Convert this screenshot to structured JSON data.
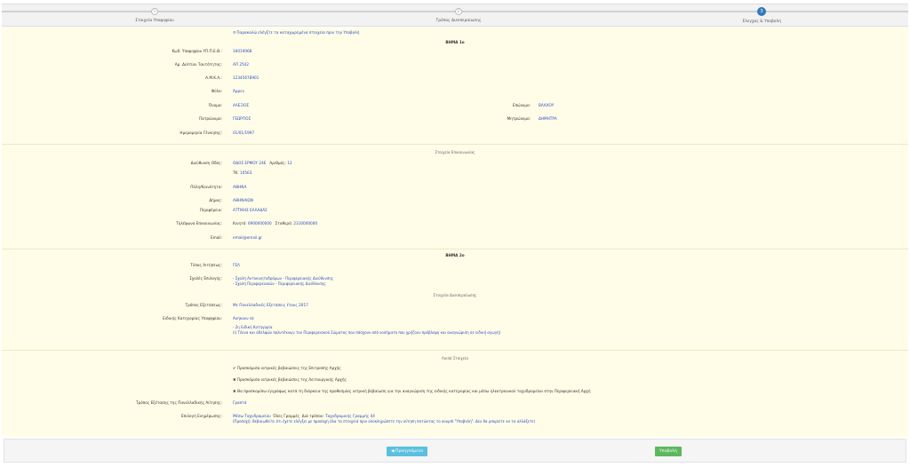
{
  "steps": [
    {
      "number": "1",
      "label": "Στοιχεία Υποψηφίου"
    },
    {
      "number": "2",
      "label": "Τρόπος Διεκπεραίωσης"
    },
    {
      "number": "3",
      "label": "Έλεγχος & Υποβολή"
    }
  ],
  "intro": "Παρακαλώ ελέγξτε τα καταχωρημένα στοιχεία πριν την Υποβολή",
  "section1": {
    "title": "ΒΗΜΑ 1ο",
    "fields": {
      "afm_label": "Κωδ. Υποψηφίου ΥΠ.Π.Ε.Θ.:",
      "afm_value": "16019068",
      "id_label": "Αρ. Δελτίου Ταυτότητας:",
      "id_value": "ΑΠ 2542",
      "amka_label": "Α.Μ.Κ.Α.:",
      "amka_value": "12345678901",
      "gender_label": "Φύλο:",
      "gender_value": "Άρρεν",
      "firstname_label": "Όνομα:",
      "firstname_value": "ΑΛΕΞΙΟΣ",
      "lastname_label": "Επώνυμο:",
      "lastname_value": "ΒΛΑΧΟΥ",
      "father_label": "Πατρώνυμο:",
      "father_value": "ΓΕΩΡΓΙΟΣ",
      "mother_label": "Μητρώνυμο:",
      "mother_value": "ΔΗΜΗΤΡΑ",
      "birthdate_label": "Ημερομηνία Γέννησης:",
      "birthdate_value": "01/01/1997"
    }
  },
  "contact": {
    "title": "Στοιχεία Επικοινωνίας",
    "address_label": "Διεύθυνση Οδός:",
    "address_value": "ΟΔΟΣ ΕΡΜΟΥ 24Ε",
    "number_label": "Αριθμός:",
    "number_value": "12",
    "tk_label": "ΤΚ:",
    "tk_value": "10563",
    "city_label": "Πόλη/Κοινότητα:",
    "city_value": "ΑΘΗΝΑ",
    "municipality_label": "Δήμος:",
    "municipality_value": "ΑΘΗΝΑΙΩΝ",
    "region_label": "Περιφέρεια:",
    "region_value": "ΑΤΤΙΚΗΣ ΕΛΛΑΔΑΣ",
    "phone_label": "Τηλέφωνα Επικοινωνίας:",
    "mobile_label": "Κινητό:",
    "mobile_value": "6900000000",
    "fixed_label": "Σταθερό:",
    "fixed_value": "2310000000",
    "email_label": "Email:",
    "email_value": "email@email.gr"
  },
  "section2": {
    "title": "ΒΗΜΑ 2ο",
    "type_label": "Τύπος Αιτήσεως:",
    "type_value": "ΓΕΛ",
    "choice_label": "Σχολές Επιλογής:",
    "choices": [
      "- Σχολή Αυτοκινητοδρόμων - Περιφερειακής Διεύθυνσης",
      "- Σχολή Περιφερειακών - Περιφερειακής Διεύθυνσης"
    ],
    "subtitle": "Στοιχεία Διεκπεραίωσης",
    "exam_label": "Τρόπος Εξετάσεως:",
    "exam_value": "Με Πανελλαδικές Εξετάσεις έτους 2017",
    "category_label": "Ειδικής Κατηγορίας Υποψηφίου:",
    "category_value": "Ανήκουν σε",
    "category_note_1": "- 2η Ειδική Κατηγορία",
    "category_note_2": "(i) Τέκνα και αδελφών πολυτέκνων του Περιφερειακού Σώματος που πάσχουν από νοσήματα που χρήζουν πρόβλεψη και αναγνώριση σε ειδική αγωγή)"
  },
  "section3": {
    "title": "Λοιπά Στοιχεία",
    "check1": "✔ Προσκόμισα ιατρικές βεβαιώσεις της Επιτροπής Αρχής",
    "check2": "✖ Προσκόμισα ιατρικές βεβαιώσεις της Λειτουργικής Αρχής",
    "check3": "✖ Θα προσκομίσω εγγράφως κατά τη διάρκεια της προθεσμίας ιατρική βεβαίωση για την αναγνώριση της ειδικής κατηγορίας και μέσω ηλεκτρονικού ταχυδρομείου στην Περιφερειακή Αρχή",
    "delivery_label": "Τρόπος Εξέτασης της Πανελλαδικής Αίτησης:",
    "delivery_value": "Γραπτά",
    "notify_label": "Επιλογή Ενημέρωσης:",
    "notify_value_1": "Μέσω Ταχυδρομείου",
    "notify_value_2": "Όλες Γραμμές",
    "notify_value_3": "Διά τρόπου:",
    "notify_value_4": "Ταχυδρομικής Γραμμής 44",
    "notify_note": "(Προσοχή: Βεβαιωθείτε ότι έχετε ελέγξει με προσοχή όλα τα στοιχεία πριν ολοκληρώσετε την αίτηση πατώντας το κουμπί \"Υποβολή\". Δεν θα μπορείτε να τα αλλάξετε)"
  },
  "footer": {
    "prev_label": "◀ Προηγούμενο",
    "submit_label": "Υποβολή"
  }
}
